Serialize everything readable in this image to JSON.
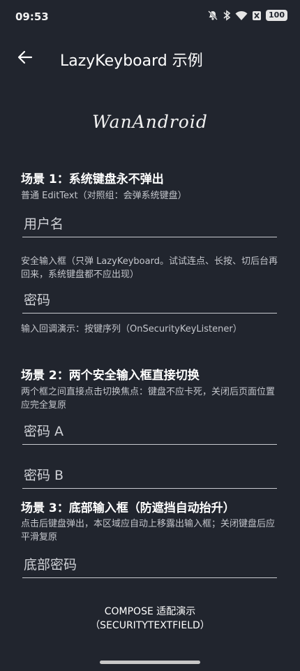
{
  "status_bar": {
    "time": "09:53",
    "battery": "100",
    "icons": [
      "bell-off-icon",
      "bluetooth-icon",
      "wifi-icon",
      "sim-off-icon"
    ]
  },
  "app_bar": {
    "title": "LazyKeyboard 示例",
    "back_icon": "arrow-back-icon"
  },
  "logo": {
    "text": "WanAndroid"
  },
  "scene1": {
    "title": "场景 1：系统键盘永不弹出",
    "normal_desc": "普通 EditText（对照组：会弹系统键盘）",
    "username_placeholder": "用户名",
    "secure_desc": "安全输入框（只弹 LazyKeyboard。试试连点、长按、切后台再回来，系统键盘都不应出现）",
    "password_placeholder": "密码",
    "callback_desc": "输入回调演示：按键序列（OnSecurityKeyListener）"
  },
  "scene2": {
    "title": "场景 2：两个安全输入框直接切换",
    "desc": "两个框之间直接点击切换焦点：键盘不应卡死，关闭后页面位置应完全复原",
    "password_a_placeholder": "密码 A",
    "password_b_placeholder": "密码 B"
  },
  "scene3": {
    "title": "场景 3：底部输入框（防遮挡自动抬升）",
    "desc": "点击后键盘弹出，本区域应自动上移露出输入框；关闭键盘后应平滑复原",
    "bottom_password_placeholder": "底部密码"
  },
  "compose_button": {
    "line1": "COMPOSE 适配演示",
    "line2": "（SECURITYTEXTFIELD）"
  },
  "colors": {
    "background": "#21252e",
    "text": "#ffffff",
    "secondary_text": "#c4c6cc",
    "underline": "#c9cbd0"
  }
}
